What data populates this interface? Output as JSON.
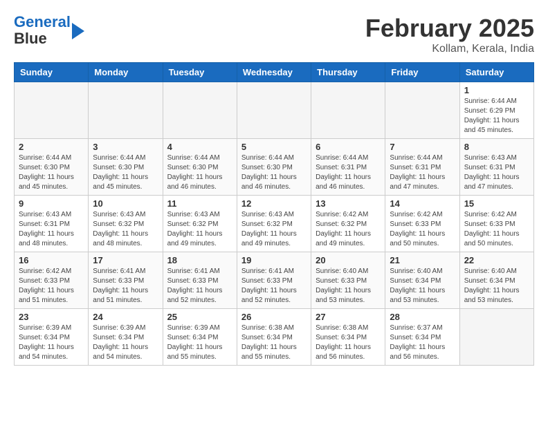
{
  "logo": {
    "line1": "General",
    "line2": "Blue"
  },
  "title": "February 2025",
  "location": "Kollam, Kerala, India",
  "weekdays": [
    "Sunday",
    "Monday",
    "Tuesday",
    "Wednesday",
    "Thursday",
    "Friday",
    "Saturday"
  ],
  "weeks": [
    [
      {
        "day": "",
        "info": ""
      },
      {
        "day": "",
        "info": ""
      },
      {
        "day": "",
        "info": ""
      },
      {
        "day": "",
        "info": ""
      },
      {
        "day": "",
        "info": ""
      },
      {
        "day": "",
        "info": ""
      },
      {
        "day": "1",
        "info": "Sunrise: 6:44 AM\nSunset: 6:29 PM\nDaylight: 11 hours and 45 minutes."
      }
    ],
    [
      {
        "day": "2",
        "info": "Sunrise: 6:44 AM\nSunset: 6:30 PM\nDaylight: 11 hours and 45 minutes."
      },
      {
        "day": "3",
        "info": "Sunrise: 6:44 AM\nSunset: 6:30 PM\nDaylight: 11 hours and 45 minutes."
      },
      {
        "day": "4",
        "info": "Sunrise: 6:44 AM\nSunset: 6:30 PM\nDaylight: 11 hours and 46 minutes."
      },
      {
        "day": "5",
        "info": "Sunrise: 6:44 AM\nSunset: 6:30 PM\nDaylight: 11 hours and 46 minutes."
      },
      {
        "day": "6",
        "info": "Sunrise: 6:44 AM\nSunset: 6:31 PM\nDaylight: 11 hours and 46 minutes."
      },
      {
        "day": "7",
        "info": "Sunrise: 6:44 AM\nSunset: 6:31 PM\nDaylight: 11 hours and 47 minutes."
      },
      {
        "day": "8",
        "info": "Sunrise: 6:43 AM\nSunset: 6:31 PM\nDaylight: 11 hours and 47 minutes."
      }
    ],
    [
      {
        "day": "9",
        "info": "Sunrise: 6:43 AM\nSunset: 6:31 PM\nDaylight: 11 hours and 48 minutes."
      },
      {
        "day": "10",
        "info": "Sunrise: 6:43 AM\nSunset: 6:32 PM\nDaylight: 11 hours and 48 minutes."
      },
      {
        "day": "11",
        "info": "Sunrise: 6:43 AM\nSunset: 6:32 PM\nDaylight: 11 hours and 49 minutes."
      },
      {
        "day": "12",
        "info": "Sunrise: 6:43 AM\nSunset: 6:32 PM\nDaylight: 11 hours and 49 minutes."
      },
      {
        "day": "13",
        "info": "Sunrise: 6:42 AM\nSunset: 6:32 PM\nDaylight: 11 hours and 49 minutes."
      },
      {
        "day": "14",
        "info": "Sunrise: 6:42 AM\nSunset: 6:33 PM\nDaylight: 11 hours and 50 minutes."
      },
      {
        "day": "15",
        "info": "Sunrise: 6:42 AM\nSunset: 6:33 PM\nDaylight: 11 hours and 50 minutes."
      }
    ],
    [
      {
        "day": "16",
        "info": "Sunrise: 6:42 AM\nSunset: 6:33 PM\nDaylight: 11 hours and 51 minutes."
      },
      {
        "day": "17",
        "info": "Sunrise: 6:41 AM\nSunset: 6:33 PM\nDaylight: 11 hours and 51 minutes."
      },
      {
        "day": "18",
        "info": "Sunrise: 6:41 AM\nSunset: 6:33 PM\nDaylight: 11 hours and 52 minutes."
      },
      {
        "day": "19",
        "info": "Sunrise: 6:41 AM\nSunset: 6:33 PM\nDaylight: 11 hours and 52 minutes."
      },
      {
        "day": "20",
        "info": "Sunrise: 6:40 AM\nSunset: 6:33 PM\nDaylight: 11 hours and 53 minutes."
      },
      {
        "day": "21",
        "info": "Sunrise: 6:40 AM\nSunset: 6:34 PM\nDaylight: 11 hours and 53 minutes."
      },
      {
        "day": "22",
        "info": "Sunrise: 6:40 AM\nSunset: 6:34 PM\nDaylight: 11 hours and 53 minutes."
      }
    ],
    [
      {
        "day": "23",
        "info": "Sunrise: 6:39 AM\nSunset: 6:34 PM\nDaylight: 11 hours and 54 minutes."
      },
      {
        "day": "24",
        "info": "Sunrise: 6:39 AM\nSunset: 6:34 PM\nDaylight: 11 hours and 54 minutes."
      },
      {
        "day": "25",
        "info": "Sunrise: 6:39 AM\nSunset: 6:34 PM\nDaylight: 11 hours and 55 minutes."
      },
      {
        "day": "26",
        "info": "Sunrise: 6:38 AM\nSunset: 6:34 PM\nDaylight: 11 hours and 55 minutes."
      },
      {
        "day": "27",
        "info": "Sunrise: 6:38 AM\nSunset: 6:34 PM\nDaylight: 11 hours and 56 minutes."
      },
      {
        "day": "28",
        "info": "Sunrise: 6:37 AM\nSunset: 6:34 PM\nDaylight: 11 hours and 56 minutes."
      },
      {
        "day": "",
        "info": ""
      }
    ]
  ]
}
